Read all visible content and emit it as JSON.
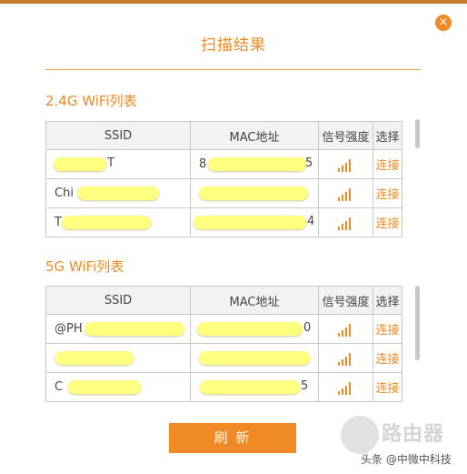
{
  "dialog": {
    "title": "扫描结果",
    "close_label": "×",
    "refresh_label": "刷 新"
  },
  "colors": {
    "accent": "#f08a24",
    "highlight": "#ffff80"
  },
  "headers": {
    "ssid": "SSID",
    "mac": "MAC地址",
    "signal": "信号强度",
    "select": "选择"
  },
  "wifi24": {
    "title": "2.4G WiFi列表",
    "rows": [
      {
        "ssid": "T",
        "mac": "8",
        "mac_end": "5",
        "action": "连接",
        "signal_icon": "signal-bars-icon"
      },
      {
        "ssid": "Chi",
        "mac": "",
        "mac_end": "",
        "action": "连接",
        "signal_icon": "signal-bars-icon"
      },
      {
        "ssid": "T",
        "mac": "",
        "mac_end": "4",
        "action": "连接",
        "signal_icon": "signal-bars-icon"
      }
    ]
  },
  "wifi5": {
    "title": "5G WiFi列表",
    "rows": [
      {
        "ssid": "@PH",
        "mac": "",
        "mac_end": "0",
        "action": "连接",
        "signal_icon": "signal-bars-icon"
      },
      {
        "ssid": "",
        "mac": "",
        "mac_end": "",
        "action": "连接",
        "signal_icon": "signal-bars-icon"
      },
      {
        "ssid": "C",
        "mac": "",
        "mac_end": "5",
        "action": "连接",
        "signal_icon": "signal-bars-icon"
      }
    ]
  },
  "watermark": {
    "brand": "路由器",
    "credit": "头条 @中微中科技"
  }
}
